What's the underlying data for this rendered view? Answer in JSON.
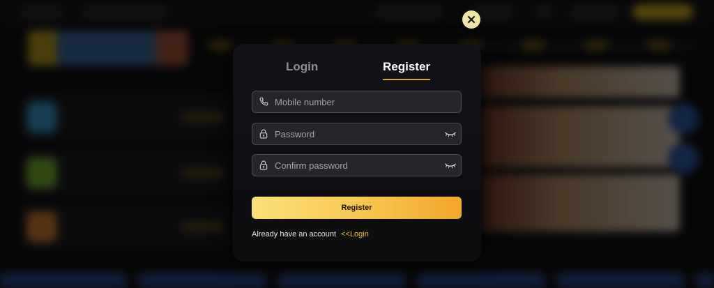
{
  "modal": {
    "tabs": [
      {
        "label": "Login",
        "active": false
      },
      {
        "label": "Register",
        "active": true
      }
    ],
    "fields": {
      "mobile": {
        "placeholder": "Mobile number",
        "value": "",
        "icon": "phone-icon"
      },
      "password": {
        "placeholder": "Password",
        "value": "",
        "icon": "lock-icon"
      },
      "confirm_password": {
        "placeholder": "Confirm password",
        "value": "",
        "icon": "lock-icon"
      }
    },
    "submit_label": "Register",
    "footer": {
      "text": "Already have an account",
      "link_label": "<<Login"
    }
  },
  "colors": {
    "accent": "#f3c52e",
    "button_gradient_start": "#fbe07a",
    "button_gradient_end": "#f1a62b",
    "close_button": "#efe6a6"
  },
  "icons": [
    "close-icon",
    "phone-icon",
    "lock-icon",
    "eye-closed-icon"
  ]
}
